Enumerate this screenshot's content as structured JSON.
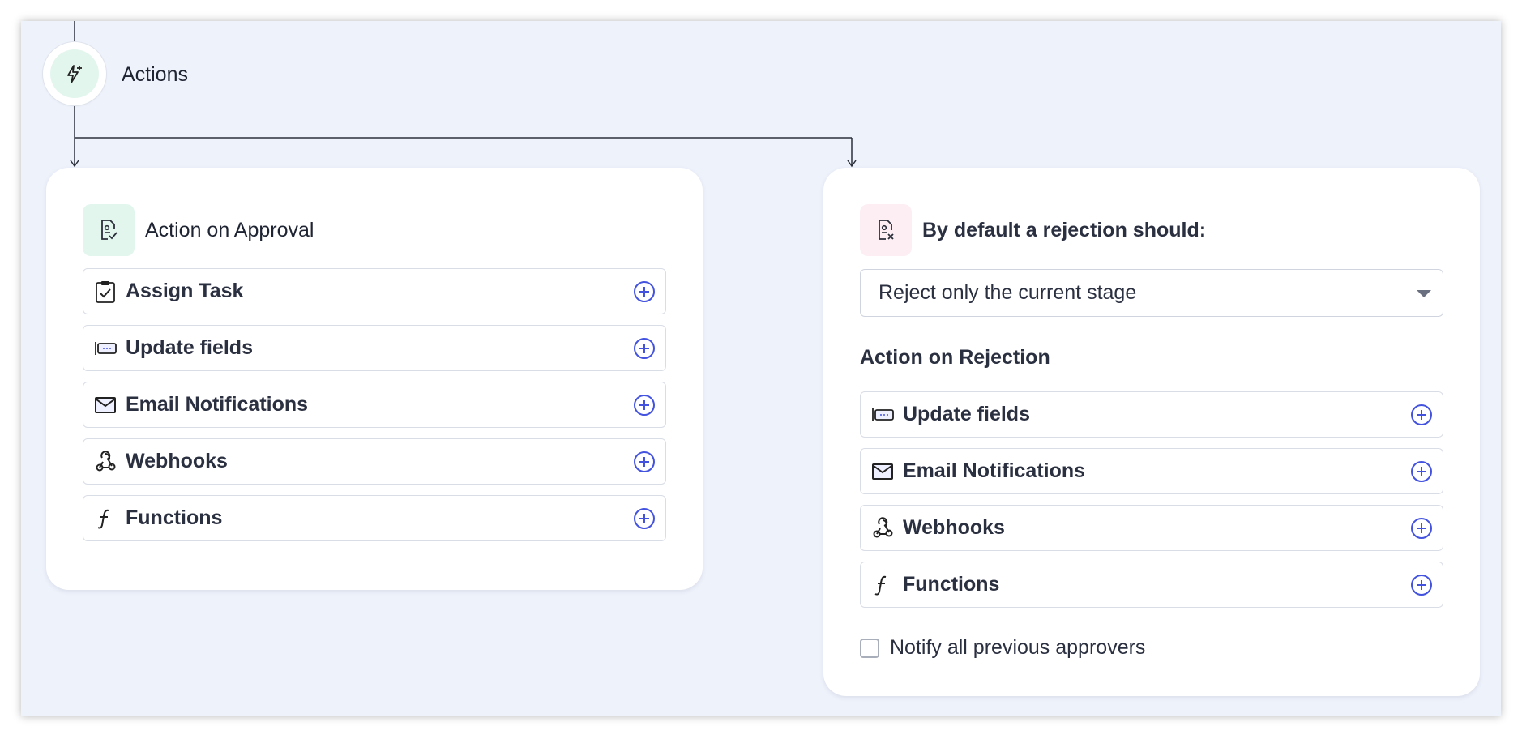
{
  "flow": {
    "node_label": "Actions",
    "node_icon": "lightning-plus-icon"
  },
  "approval_card": {
    "title": "Action on Approval",
    "icon": "document-check-icon",
    "items": [
      {
        "label": "Assign Task",
        "icon": "clipboard-check-icon"
      },
      {
        "label": "Update fields",
        "icon": "field-update-icon"
      },
      {
        "label": "Email Notifications",
        "icon": "envelope-icon"
      },
      {
        "label": "Webhooks",
        "icon": "webhook-icon"
      },
      {
        "label": "Functions",
        "icon": "function-icon"
      }
    ]
  },
  "rejection_card": {
    "title": "By default a rejection should:",
    "icon": "document-x-icon",
    "select_value": "Reject only the current stage",
    "section_label": "Action on Rejection",
    "items": [
      {
        "label": "Update fields",
        "icon": "field-update-icon"
      },
      {
        "label": "Email Notifications",
        "icon": "envelope-icon"
      },
      {
        "label": "Webhooks",
        "icon": "webhook-icon"
      },
      {
        "label": "Functions",
        "icon": "function-icon"
      }
    ],
    "checkbox_label": "Notify all previous approvers",
    "checkbox_checked": false
  },
  "colors": {
    "canvas_bg": "#eef2fb",
    "accent_blue": "#4353e0",
    "approval_tint": "#e2f6ee",
    "rejection_tint": "#fdeef4"
  }
}
